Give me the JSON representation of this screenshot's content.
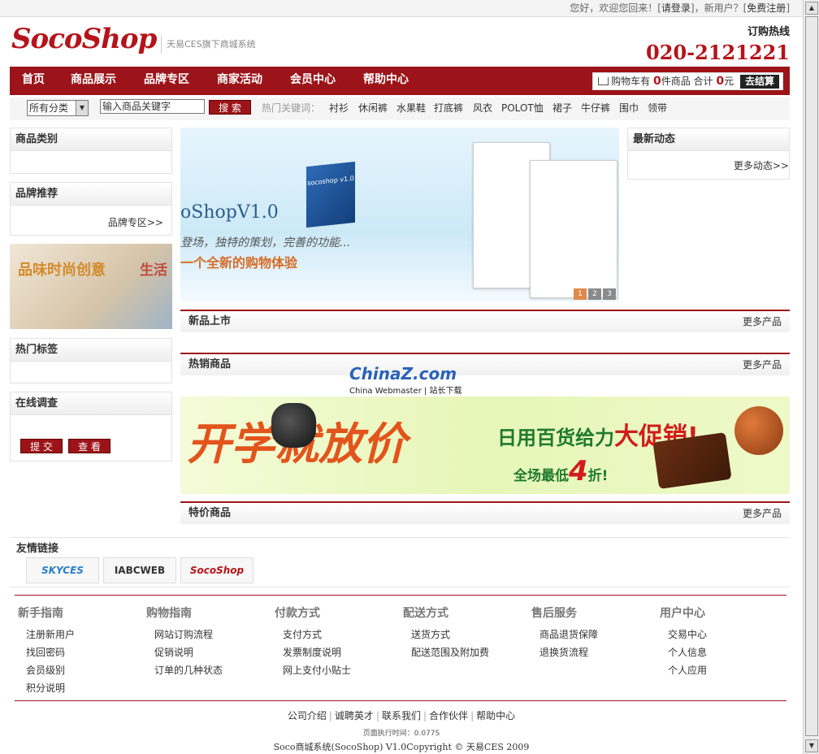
{
  "topbar": {
    "greeting": "您好，欢迎您回来！[",
    "login": "请登录",
    "mid": "]，新用户？[",
    "register": "免费注册",
    "end": "]"
  },
  "header": {
    "logo": "SocoShop",
    "slogan": "天易CES旗下商城系统",
    "hotline_label": "订购热线",
    "hotline_number": "020-2121221"
  },
  "nav": {
    "items": [
      "首页",
      "商品展示",
      "品牌专区",
      "商家活动",
      "会员中心",
      "帮助中心"
    ],
    "cart": {
      "label": "购物车有",
      "count": "0",
      "items_label": "件商品 合计",
      "total": "0",
      "currency": "元",
      "checkout": "去结算"
    }
  },
  "search": {
    "category": "所有分类",
    "input_value": "输入商品关键字",
    "button": "搜 索",
    "hot_label": "热门关键词：",
    "hot_keywords": [
      "衬衫",
      "休闲裤",
      "水果鞋",
      "打底裤",
      "风衣",
      "POLOT恤",
      "裙子",
      "牛仔裤",
      "围巾",
      "领带"
    ]
  },
  "left": {
    "category_title": "商品类别",
    "brand_title": "品牌推荐",
    "brand_more": "品牌专区>>",
    "promo_text_a": "品味时尚创意",
    "promo_text_b": "生活",
    "hot_tags_title": "热门标签",
    "survey_title": "在线调查",
    "survey_submit": "提 交",
    "survey_view": "查 看"
  },
  "banner": {
    "product_label": "socoshop v1.0",
    "title": "oShopV1.0",
    "line2": "登场，独特的策划，完善的功能...",
    "line3": "一个全新的购物体验",
    "dots": [
      "1",
      "2",
      "3"
    ]
  },
  "right": {
    "news_title": "最新动态",
    "news_more": "更多动态>>"
  },
  "sections": {
    "new": {
      "title": "新品上市",
      "more": "更多产品"
    },
    "hot": {
      "title": "热销商品",
      "more": "更多产品"
    },
    "special": {
      "title": "特价商品",
      "more": "更多产品"
    }
  },
  "watermark": {
    "brand": "ChinaZ.com",
    "sub": "China Webmaster | 站长下载"
  },
  "sale_banner": {
    "big": "开学就放价",
    "line1_a": "日用百货给力",
    "line1_b": "大促销!",
    "line2_a": "全场最低",
    "line2_b": "4",
    "line2_c": "折!"
  },
  "friend_links": {
    "title": "友情链接",
    "logos": [
      "SKYCES",
      "IABCWEB",
      "SocoShop"
    ]
  },
  "guide": [
    {
      "title": "新手指南",
      "links": [
        "注册新用户",
        "找回密码",
        "会员级别",
        "积分说明"
      ]
    },
    {
      "title": "购物指南",
      "links": [
        "网站订购流程",
        "促销说明",
        "订单的几种状态"
      ]
    },
    {
      "title": "付款方式",
      "links": [
        "支付方式",
        "发票制度说明",
        "网上支付小贴士"
      ]
    },
    {
      "title": "配送方式",
      "links": [
        "送货方式",
        "配送范围及附加费"
      ]
    },
    {
      "title": "售后服务",
      "links": [
        "商品退货保障",
        "退换货流程"
      ]
    },
    {
      "title": "用户中心",
      "links": [
        "交易中心",
        "个人信息",
        "个人应用"
      ]
    }
  ],
  "footer": {
    "links": [
      "公司介绍",
      "诚聘英才",
      "联系我们",
      "合作伙伴",
      "帮助中心"
    ],
    "exec_time": "页面执行时间：0.077S",
    "copyright": "Soco商城系统(SocoShop) V1.0Copyright © 天易CES 2009"
  }
}
